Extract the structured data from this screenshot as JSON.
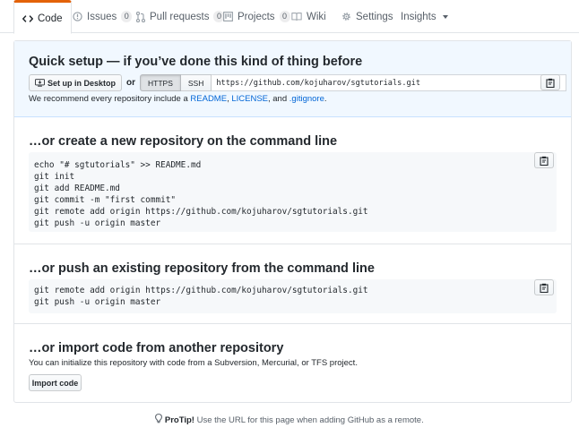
{
  "tabs": [
    {
      "label": "Code",
      "icon": "code-icon",
      "selected": true
    },
    {
      "label": "Issues",
      "icon": "issue-opened-icon",
      "count": "0"
    },
    {
      "label": "Pull requests",
      "icon": "git-pull-request-icon",
      "count": "0"
    },
    {
      "label": "Projects",
      "icon": "project-icon",
      "count": "0"
    },
    {
      "label": "Wiki",
      "icon": "book-icon"
    },
    {
      "label": "Settings",
      "icon": "gear-icon"
    },
    {
      "label": "Insights",
      "icon": "triangle-down-icon"
    }
  ],
  "quick_setup": {
    "title": "Quick setup — if you’ve done this kind of thing before",
    "desktop_button": "Set up in Desktop",
    "or": "or",
    "https_label": "HTTPS",
    "ssh_label": "SSH",
    "clone_url": "https://github.com/kojuharov/sgtutorials.git",
    "recommend_prefix": "We recommend every repository include a ",
    "readme": "README",
    "sep1": ", ",
    "license": "LICENSE",
    "sep2": ", and ",
    "gitignore": ".gitignore",
    "suffix": "."
  },
  "new_repo": {
    "title": "…or create a new repository on the command line",
    "lines": [
      "echo \"# sgtutorials\" >> README.md",
      "git init",
      "git add README.md",
      "git commit -m \"first commit\"",
      "git remote add origin https://github.com/kojuharov/sgtutorials.git",
      "git push -u origin master"
    ]
  },
  "push_existing": {
    "title": "…or push an existing repository from the command line",
    "lines": [
      "git remote add origin https://github.com/kojuharov/sgtutorials.git",
      "git push -u origin master"
    ]
  },
  "import": {
    "title": "…or import code from another repository",
    "description": "You can initialize this repository with code from a Subversion, Mercurial, or TFS project.",
    "button": "Import code"
  },
  "protip": {
    "label": "ProTip!",
    "text": " Use the URL for this page when adding GitHub as a remote."
  },
  "colors": {
    "accent_orange": "#e36209",
    "link_blue": "#0366d6",
    "quick_setup_bg": "#f1f8ff"
  }
}
